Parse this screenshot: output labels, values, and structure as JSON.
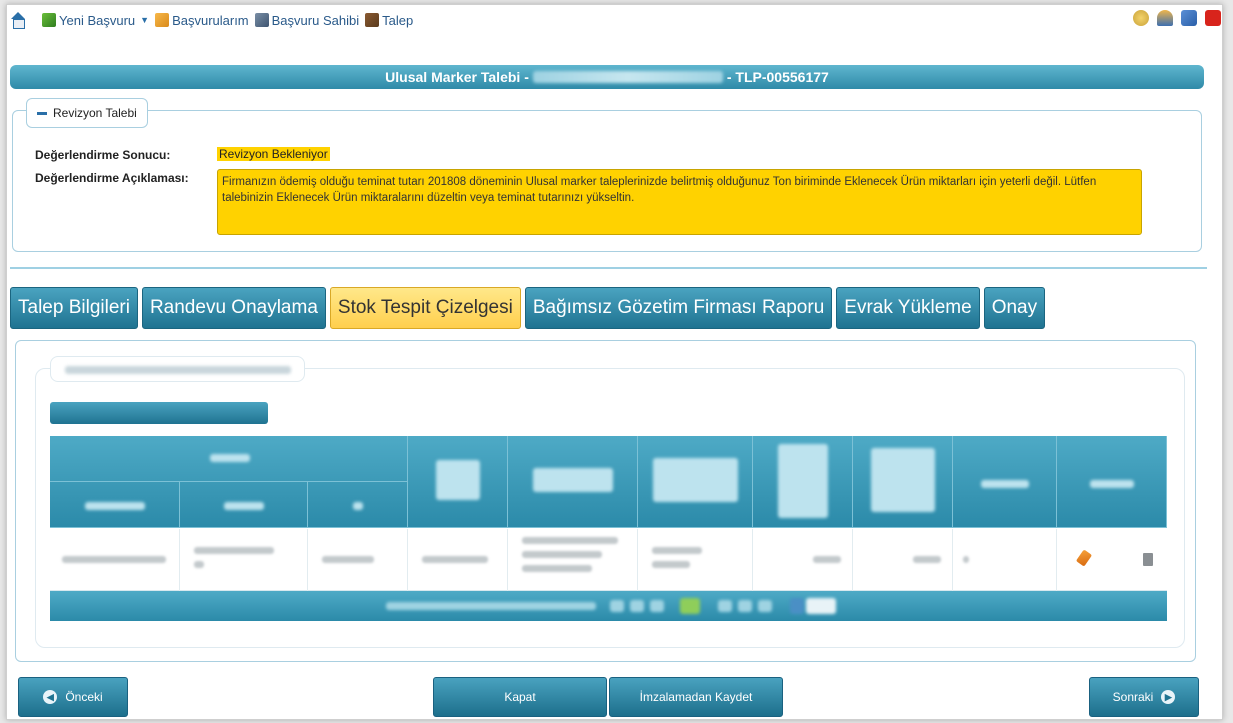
{
  "topnav": {
    "new_application": "Yeni Başvuru",
    "my_applications": "Başvurularım",
    "applicant": "Başvuru Sahibi",
    "request": "Talep"
  },
  "title_bar": {
    "prefix": "Ulusal Marker Talebi -",
    "suffix": "- TLP-00556177"
  },
  "revision": {
    "legend": "Revizyon Talebi",
    "result_label": "Değerlendirme Sonucu:",
    "result_value": "Revizyon Bekleniyor",
    "description_label": "Değerlendirme Açıklaması:",
    "description_value": "Firmanızın ödemiş olduğu teminat tutarı 201808 döneminin Ulusal marker taleplerinizde belirtmiş olduğunuz Ton biriminde Eklenecek Ürün miktarları için yeterli değil. Lütfen talebinizin Eklenecek Ürün miktaralarını düzeltin veya teminat tutarınızı yükseltin."
  },
  "tabs": [
    {
      "label": "Talep Bilgileri",
      "active": false
    },
    {
      "label": "Randevu Onaylama",
      "active": false
    },
    {
      "label": "Stok Tespit Çizelgesi",
      "active": true
    },
    {
      "label": "Bağımsız Gözetim Firması Raporu",
      "active": false
    },
    {
      "label": "Evrak Yükleme",
      "active": false
    },
    {
      "label": "Onay",
      "active": false
    }
  ],
  "buttons": {
    "previous": "Önceki",
    "close": "Kapat",
    "save_unsigned": "İmzalamadan Kaydet",
    "next": "Sonraki"
  },
  "colors": {
    "accent": "#2f8aa8",
    "highlight": "#ffd200",
    "active_tab": "#ffcf4d"
  }
}
